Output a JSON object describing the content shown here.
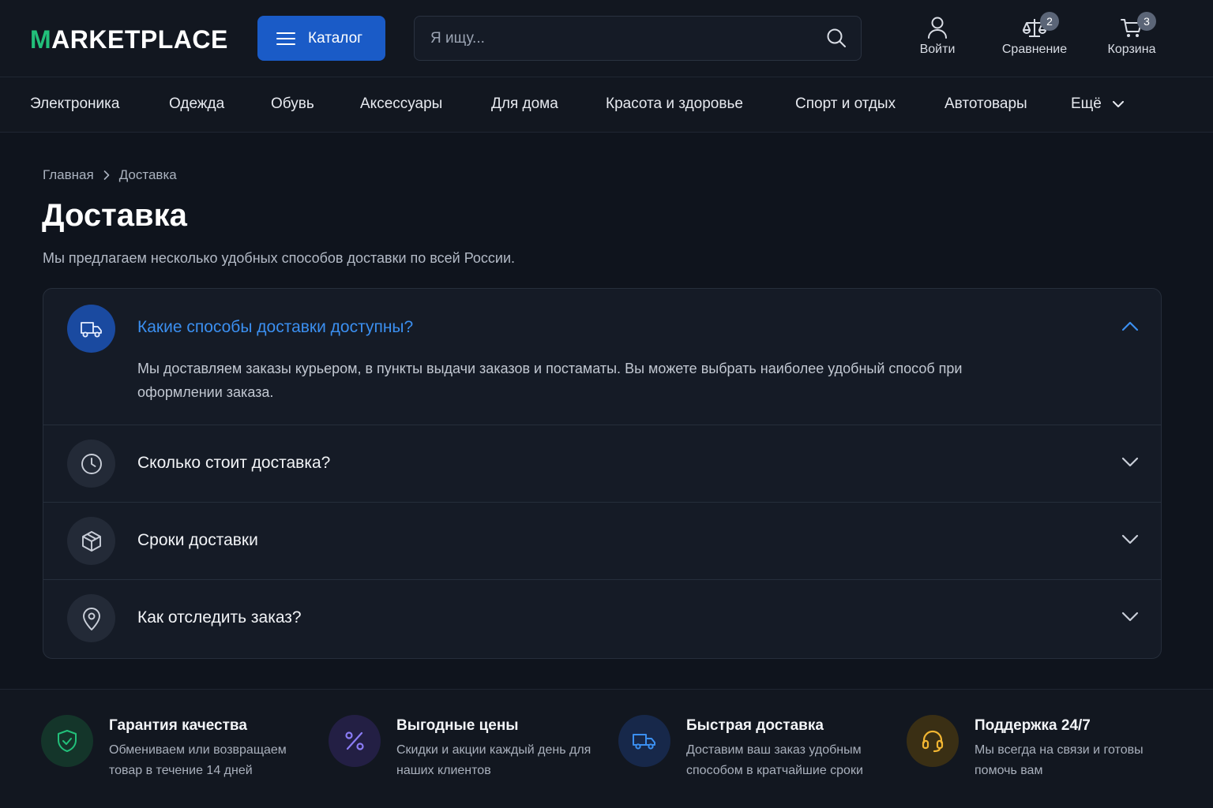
{
  "header": {
    "logo_first": "M",
    "logo_rest": "ARKETPLACE",
    "catalog_label": "Каталог",
    "search_placeholder": "Я ищу...",
    "login_label": "Войти",
    "compare_label": "Сравнение",
    "compare_count": "2",
    "cart_label": "Корзина",
    "cart_count": "3"
  },
  "categories": [
    "Электроника",
    "Одежда",
    "Обувь",
    "Аксессуары",
    "Для дома",
    "Красота и здоровье",
    "Спорт и отдых",
    "Автотовары"
  ],
  "more_label": "Ещё",
  "breadcrumb": {
    "home": "Главная",
    "current": "Доставка"
  },
  "page": {
    "title": "Доставка",
    "subtitle": "Мы предлагаем несколько удобных способов доставки по всей России."
  },
  "faq": [
    {
      "icon": "truck-icon",
      "question": "Какие способы доставки доступны?",
      "answer": "Мы доставляем заказы курьером, в пункты выдачи заказов и постаматы. Вы можете выбрать наиболее удобный способ при оформлении заказа.",
      "expanded": true
    },
    {
      "icon": "clock-icon",
      "question": "Сколько стоит доставка?",
      "expanded": false
    },
    {
      "icon": "box-icon",
      "question": "Сроки доставки",
      "expanded": false
    },
    {
      "icon": "location-pin-icon",
      "question": "Как отследить заказ?",
      "expanded": false
    }
  ],
  "features": [
    {
      "icon": "shield-check-icon",
      "title": "Гарантия качества",
      "desc": "Обмениваем или возвращаем товар в течение 14 дней",
      "color": "#22c07a"
    },
    {
      "icon": "percent-icon",
      "title": "Выгодные цены",
      "desc": "Скидки и акции каждый день для наших клиентов",
      "color": "#8b7cf6"
    },
    {
      "icon": "truck-icon",
      "title": "Быстрая доставка",
      "desc": "Доставим ваш заказ удобным способом в кратчайшие сроки",
      "color": "#3b8ff0"
    },
    {
      "icon": "headset-icon",
      "title": "Поддержка 24/7",
      "desc": "Мы всегда на связи и готовы помочь вам",
      "color": "#f2b632"
    }
  ],
  "colors": {
    "accent": "#1a5bc7",
    "accent_text": "#3b8ff0",
    "brand_green": "#22c07a",
    "background": "#0f141d"
  }
}
